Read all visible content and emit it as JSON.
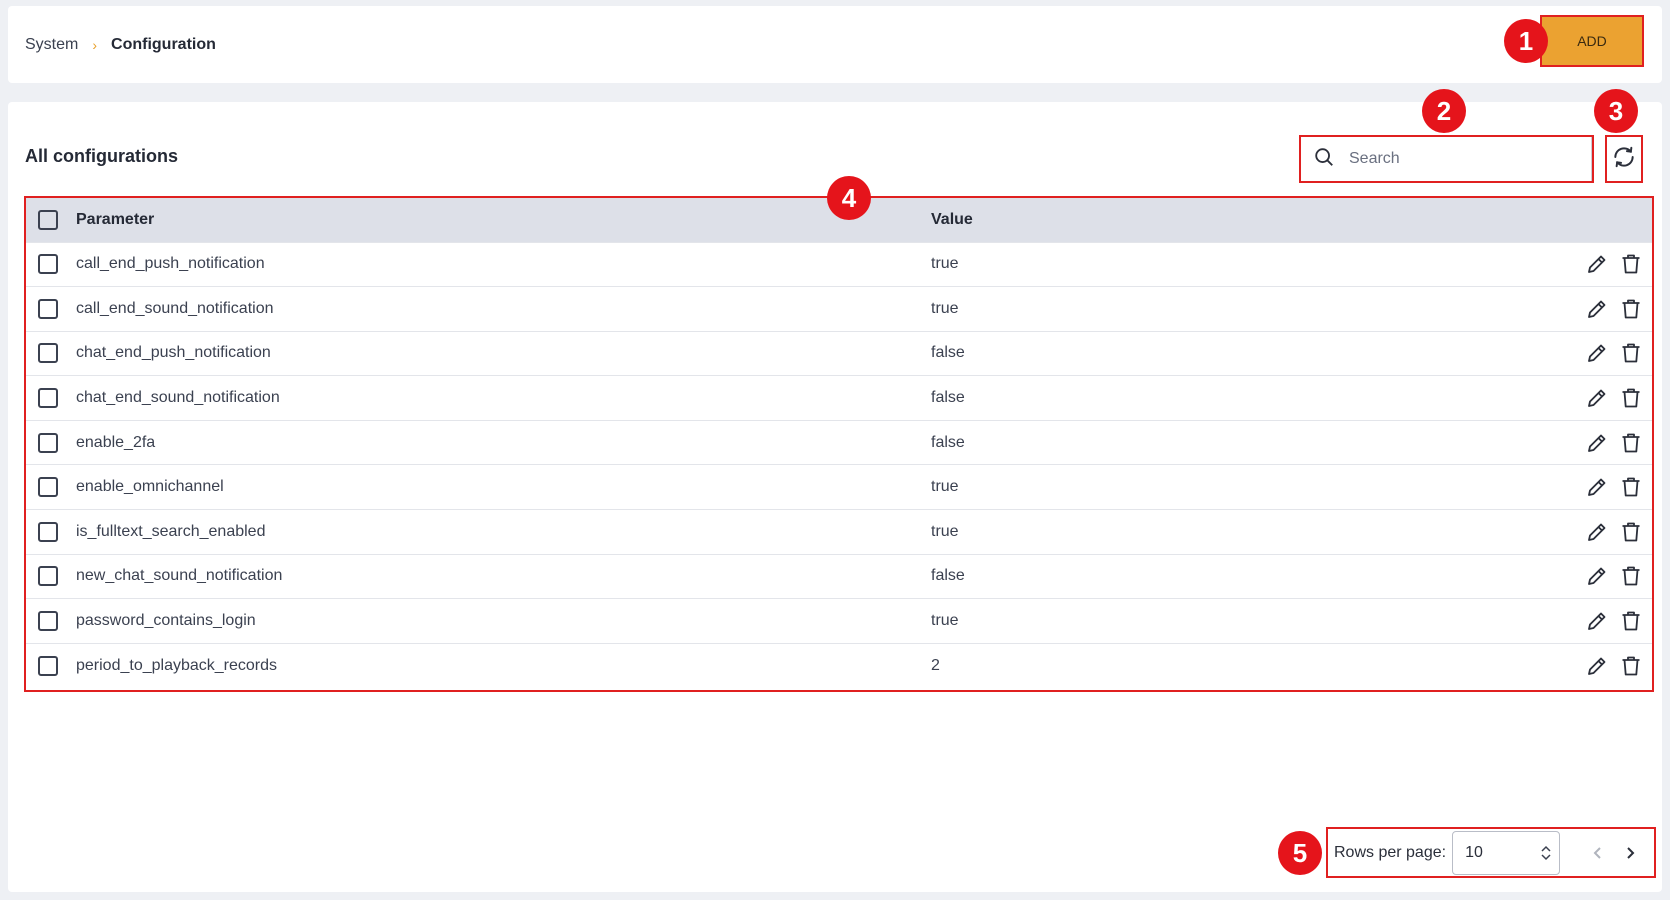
{
  "breadcrumb": {
    "parent": "System",
    "separator": "›",
    "current": "Configuration"
  },
  "header": {
    "add_label": "ADD"
  },
  "badges": [
    "1",
    "2",
    "3",
    "4",
    "5"
  ],
  "section": {
    "title": "All configurations"
  },
  "search": {
    "placeholder": "Search",
    "value": ""
  },
  "table": {
    "columns": {
      "parameter": "Parameter",
      "value": "Value"
    },
    "rows": [
      {
        "parameter": "call_end_push_notification",
        "value": "true"
      },
      {
        "parameter": "call_end_sound_notification",
        "value": "true"
      },
      {
        "parameter": "chat_end_push_notification",
        "value": "false"
      },
      {
        "parameter": "chat_end_sound_notification",
        "value": "false"
      },
      {
        "parameter": "enable_2fa",
        "value": "false"
      },
      {
        "parameter": "enable_omnichannel",
        "value": "true"
      },
      {
        "parameter": "is_fulltext_search_enabled",
        "value": "true"
      },
      {
        "parameter": "new_chat_sound_notification",
        "value": "false"
      },
      {
        "parameter": "password_contains_login",
        "value": "true"
      },
      {
        "parameter": "period_to_playback_records",
        "value": "2"
      }
    ]
  },
  "pagination": {
    "rows_per_page_label": "Rows per page:",
    "rows_per_page_value": "10"
  },
  "colors": {
    "accent": "#eba231",
    "highlight": "#e02020",
    "badge": "#e5141b",
    "header_bg": "#dde0e8"
  }
}
